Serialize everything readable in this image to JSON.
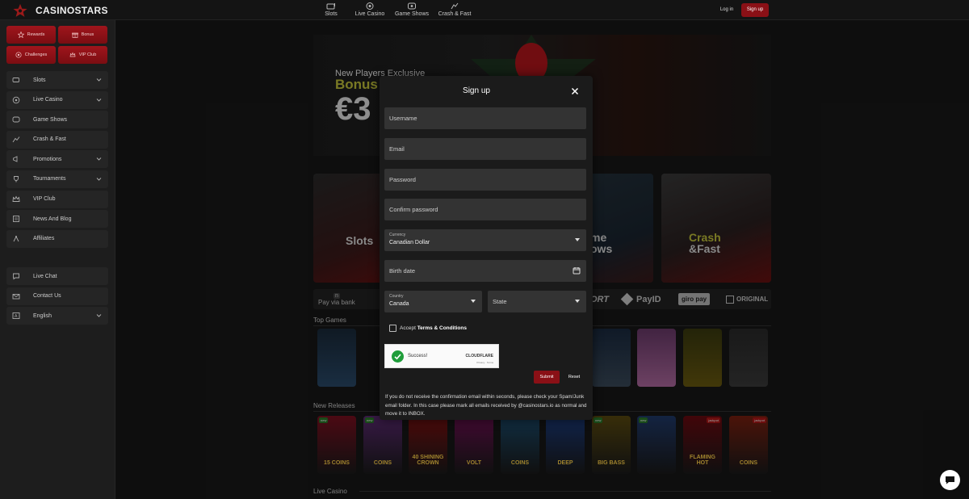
{
  "brand": {
    "name": "CASINOSTARS"
  },
  "topnav": [
    {
      "label": "Slots",
      "icon": "slots-icon"
    },
    {
      "label": "Live Casino",
      "icon": "live-casino-icon"
    },
    {
      "label": "Game Shows",
      "icon": "game-shows-icon"
    },
    {
      "label": "Crash & Fast",
      "icon": "crash-icon"
    }
  ],
  "auth": {
    "login": "Log in",
    "signup": "Sign up"
  },
  "quick": [
    {
      "label": "Rewards",
      "icon": "rewards-icon"
    },
    {
      "label": "Bonus",
      "icon": "gift-icon"
    },
    {
      "label": "Challenges",
      "icon": "challenges-icon"
    },
    {
      "label": "VIP Club",
      "icon": "vip-icon"
    }
  ],
  "sidebar": {
    "items": [
      {
        "label": "Slots",
        "chevron": true
      },
      {
        "label": "Live Casino",
        "chevron": true
      },
      {
        "label": "Game Shows",
        "chevron": false
      },
      {
        "label": "Crash & Fast",
        "chevron": false
      },
      {
        "label": "Promotions",
        "chevron": true
      },
      {
        "label": "Tournaments",
        "chevron": true
      },
      {
        "label": "VIP Club",
        "chevron": false
      },
      {
        "label": "News And Blog",
        "chevron": false
      },
      {
        "label": "Affiliates",
        "chevron": false
      }
    ],
    "support": [
      {
        "label": "Live Chat",
        "chevron": false
      },
      {
        "label": "Contact Us",
        "chevron": false
      },
      {
        "label": "English",
        "chevron": true
      }
    ]
  },
  "banner": {
    "line1": "New Players Exclusive",
    "line2": "Bonus",
    "line3": "€3"
  },
  "categories": {
    "slots": "Slots",
    "gameshows_a": "me",
    "gameshows_b": "ows",
    "crash_a": "Crash",
    "crash_b": "&Fast"
  },
  "payments": {
    "bank": "Pay via bank",
    "sport": "ORT",
    "payid": "PayID",
    "giropay": "giro pay",
    "original": "ORIGINAL"
  },
  "sections": {
    "top": "Top Games",
    "new": "New Releases",
    "live": "Live Casino"
  },
  "new_games": [
    {
      "title": "15 COINS",
      "badge": "new",
      "color": "#7a1020"
    },
    {
      "title": "COINS",
      "badge": "new",
      "color": "#5a2a70"
    },
    {
      "title": "40 SHINING CROWN",
      "badge": "",
      "color": "#7a1010"
    },
    {
      "title": "VOLT",
      "badge": "",
      "color": "#6a1050"
    },
    {
      "title": "COINS",
      "badge": "",
      "color": "#1a4a6a"
    },
    {
      "title": "DEEP",
      "badge": "",
      "color": "#1a3a7a"
    },
    {
      "title": "BIG BASS",
      "badge": "new",
      "color": "#5a4a10"
    },
    {
      "title": "",
      "badge": "new",
      "color": "#203a6a"
    },
    {
      "title": "FLAMING HOT",
      "badge": "jackpot",
      "color": "#6a0a10"
    },
    {
      "title": "COINS",
      "badge": "jackpot",
      "color": "#7a2010"
    }
  ],
  "modal": {
    "title": "Sign up",
    "username_ph": "Username",
    "email_ph": "Email",
    "password_ph": "Password",
    "confirm_ph": "Confirm password",
    "currency_label": "Currency",
    "currency_value": "Canadian Dollar",
    "birth_ph": "Birth date",
    "country_label": "Country",
    "country_value": "Canada",
    "state_ph": "State",
    "accept_prefix": "Accept",
    "accept_link": "Terms & Conditions",
    "captcha_status": "Success!",
    "captcha_brand": "CLOUDFLARE",
    "captcha_links": "Privacy · Terms",
    "submit": "Submit",
    "reset": "Reset",
    "notice": "If you do not receive the confirmation email within seconds, please check your Spam/Junk email folder. In this case please mark all emails received by @casinostars.io as normal and move it to INBOX."
  },
  "colors": {
    "accent": "#8a1016",
    "banner_yellow": "#c4c43a",
    "success": "#1f9d3a"
  }
}
